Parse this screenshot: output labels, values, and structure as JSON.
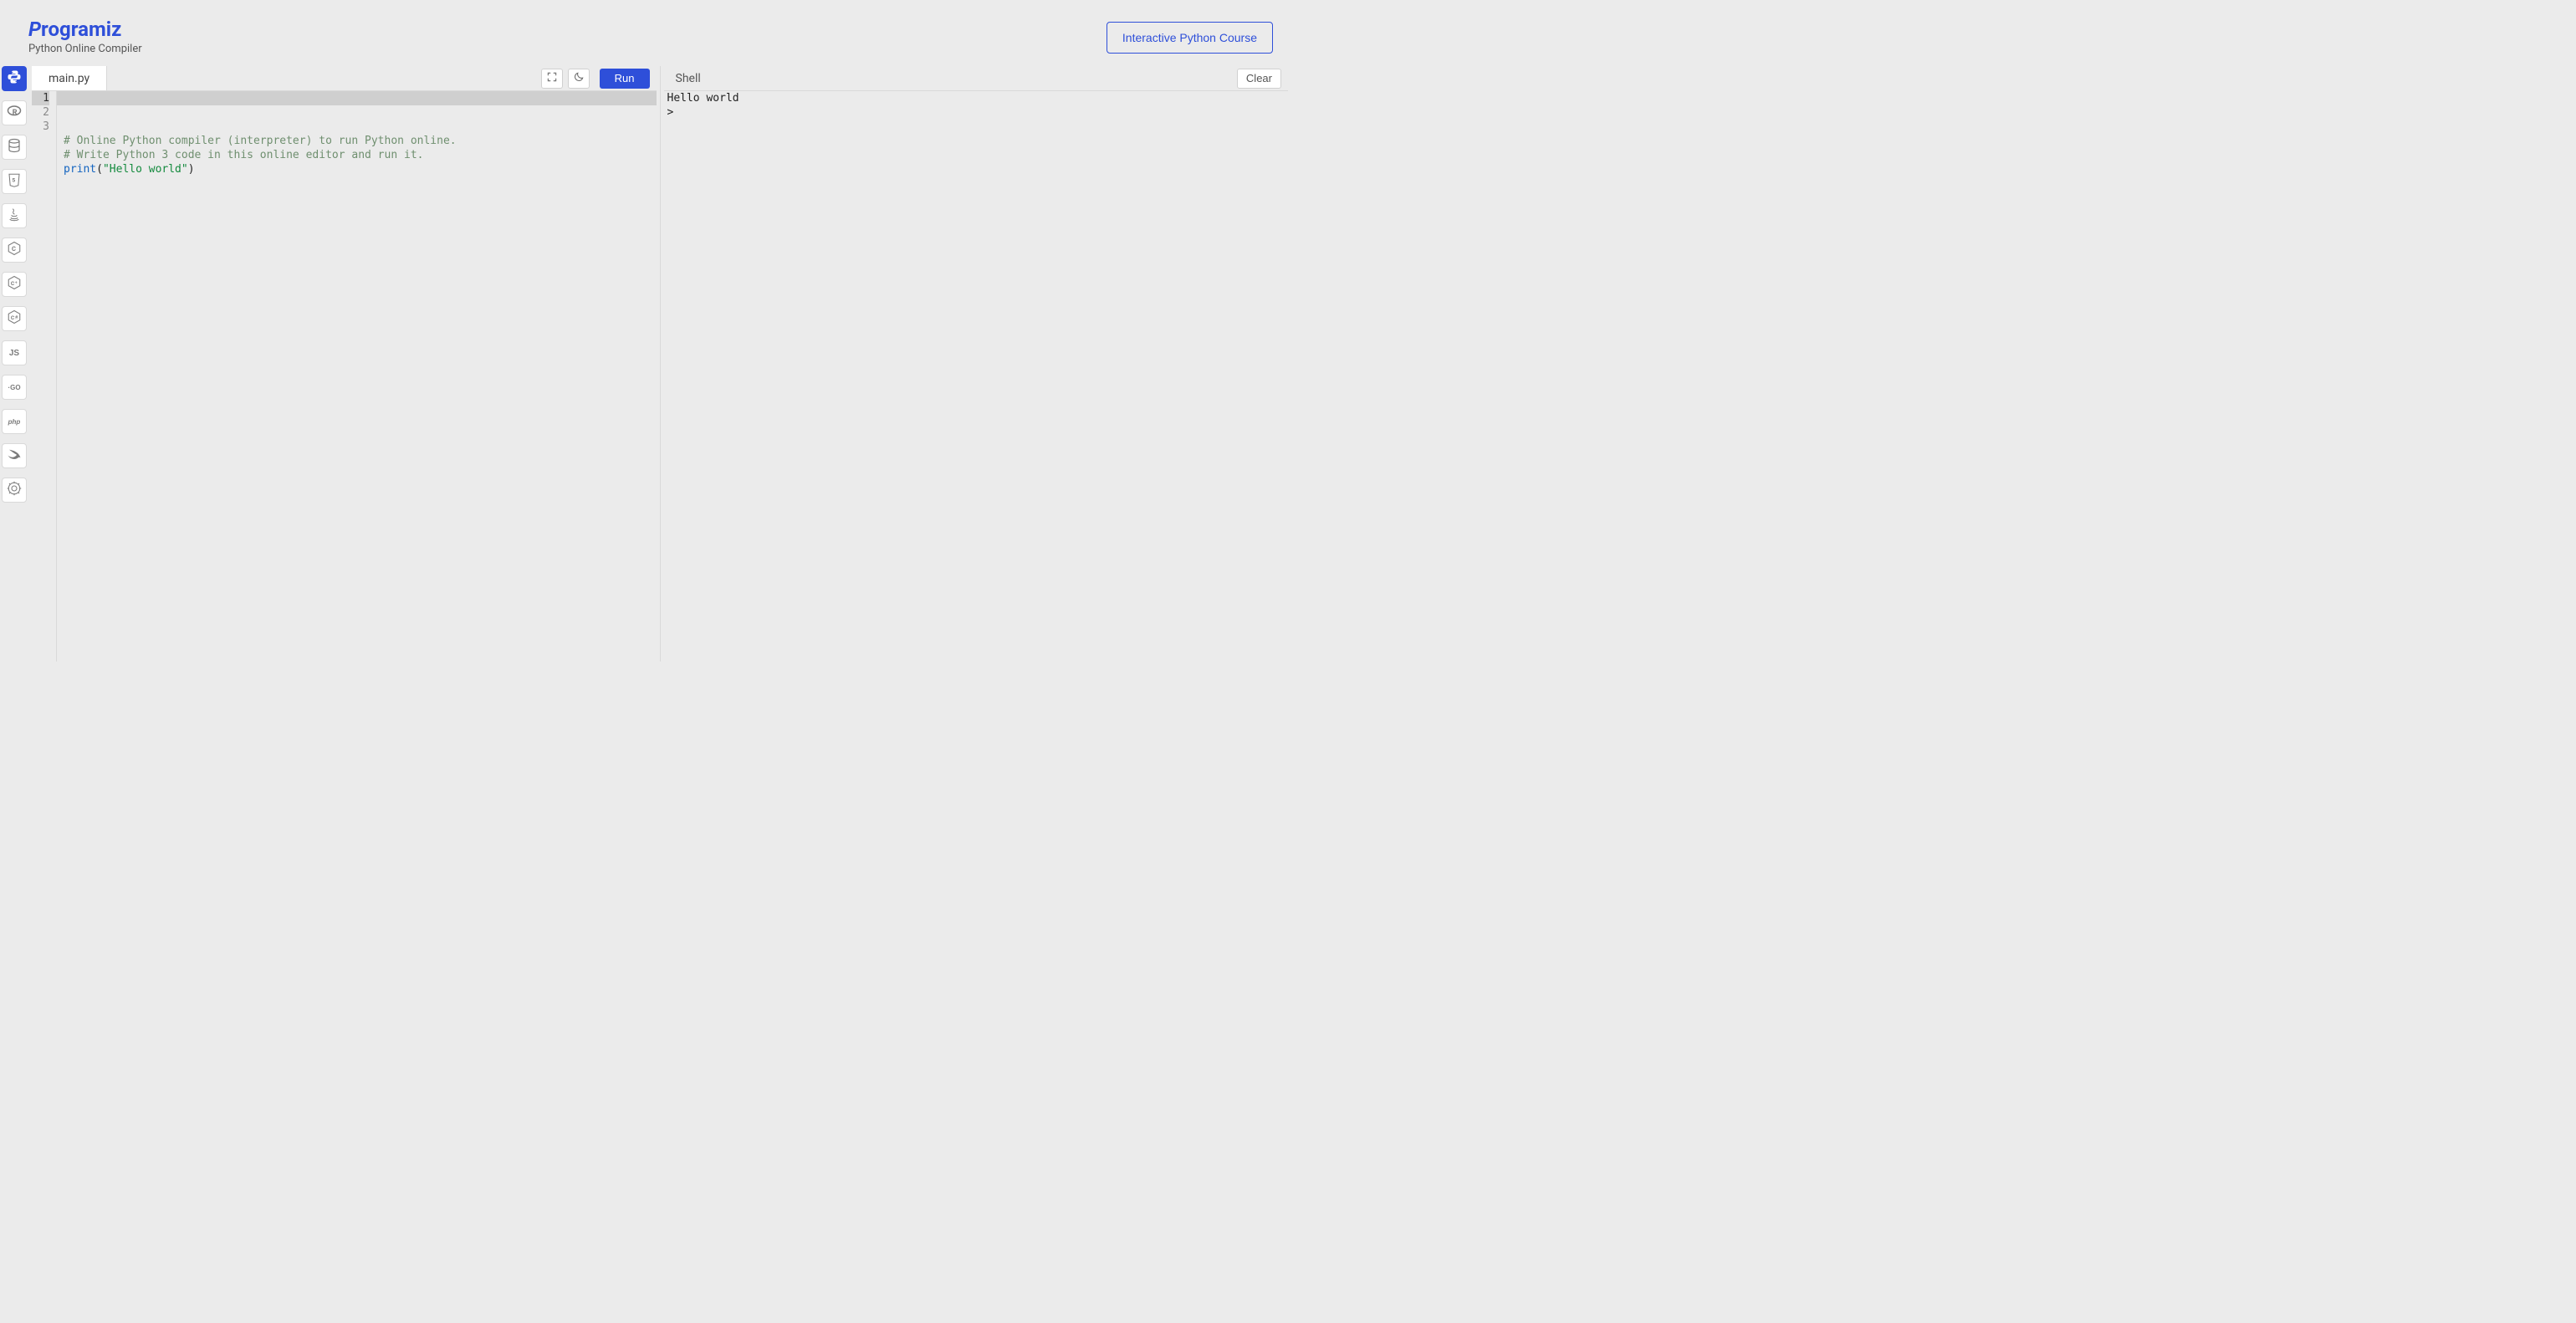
{
  "header": {
    "brand": "Programiz",
    "subtitle": "Python Online Compiler",
    "course_button": "Interactive Python Course"
  },
  "sidebar_langs": [
    {
      "id": "python",
      "label": "Py",
      "active": true
    },
    {
      "id": "r",
      "label": "R",
      "active": false
    },
    {
      "id": "sql",
      "label": "DB",
      "active": false
    },
    {
      "id": "html",
      "label": "5",
      "active": false
    },
    {
      "id": "java",
      "label": "J",
      "active": false
    },
    {
      "id": "c",
      "label": "C",
      "active": false
    },
    {
      "id": "cpp",
      "label": "C",
      "active": false
    },
    {
      "id": "csharp",
      "label": "C",
      "active": false
    },
    {
      "id": "js",
      "label": "JS",
      "active": false
    },
    {
      "id": "go",
      "label": "·GO",
      "active": false
    },
    {
      "id": "php",
      "label": "php",
      "active": false
    },
    {
      "id": "swift",
      "label": "Sw",
      "active": false
    },
    {
      "id": "rust",
      "label": "Ru",
      "active": false
    }
  ],
  "editor": {
    "file_tab": "main.py",
    "run_label": "Run",
    "active_line": 1,
    "tokens": [
      [
        {
          "cls": "tok-comment",
          "text": "# Online Python compiler (interpreter) to run Python online."
        }
      ],
      [
        {
          "cls": "tok-comment",
          "text": "# Write Python 3 code in this online editor and run it."
        }
      ],
      [
        {
          "cls": "tok-builtin",
          "text": "print"
        },
        {
          "cls": "tok-punc",
          "text": "("
        },
        {
          "cls": "tok-string",
          "text": "\"Hello world\""
        },
        {
          "cls": "tok-punc",
          "text": ")"
        }
      ]
    ]
  },
  "shell": {
    "title": "Shell",
    "clear_label": "Clear",
    "output": [
      "Hello world",
      ">"
    ]
  }
}
